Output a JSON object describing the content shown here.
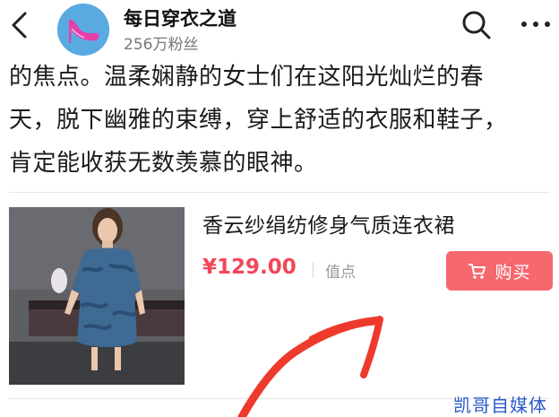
{
  "header": {
    "account_name": "每日穿衣之道",
    "followers": "256万粉丝"
  },
  "article": {
    "lines": [
      "的焦点。温柔娴静的女士们在这阳光灿烂的春",
      "天，脱下幽雅的束缚，穿上舒适的衣服和鞋子，",
      "肯定能收获无数羡慕的眼神。"
    ]
  },
  "product": {
    "title": "香云纱绢纺修身气质连衣裙",
    "price": "¥129.00",
    "source": "值点",
    "buy_label": "购买"
  },
  "watermark": "凯哥自媒体",
  "colors": {
    "price": "#f2475a",
    "buy_button": "#f7676e",
    "annotation_arrow": "#ee3a2c",
    "watermark": "#2a5ac8"
  },
  "icons": [
    "back-arrow-icon",
    "search-icon",
    "more-dots-icon",
    "cart-icon"
  ]
}
